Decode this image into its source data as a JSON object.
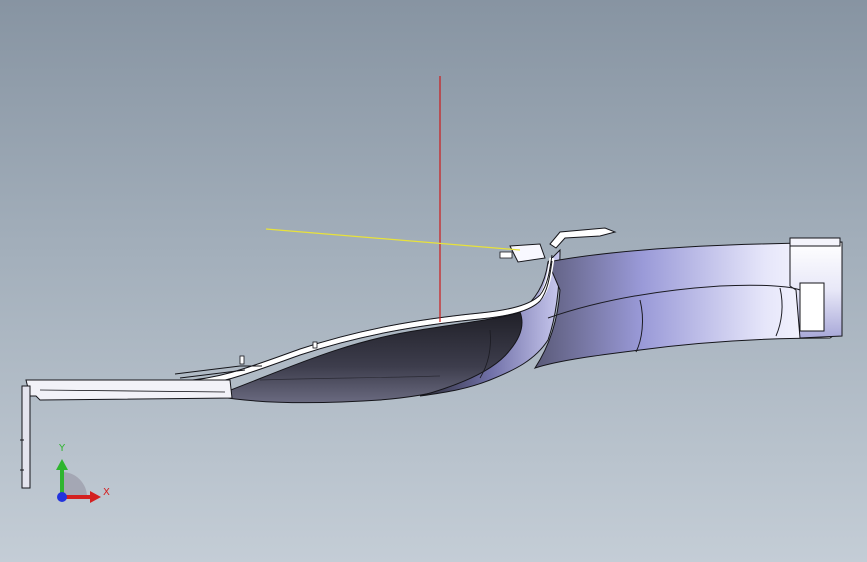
{
  "viewport": {
    "background_top": "#8794a2",
    "background_bottom": "#c4cdd6"
  },
  "reference_axes": {
    "vertical_line_color": "#cc1a1a",
    "horizontal_line_color": "#e8e23a"
  },
  "model": {
    "shade_light": "#ffffff",
    "shade_mid": "#b9b9e6",
    "shade_dark": "#3a3a48",
    "edge_color": "#15151a"
  },
  "triad": {
    "y_label": "Y",
    "x_label": "X",
    "y_color": "#2fb52f",
    "x_color": "#d42020",
    "z_color": "#2233dd"
  }
}
